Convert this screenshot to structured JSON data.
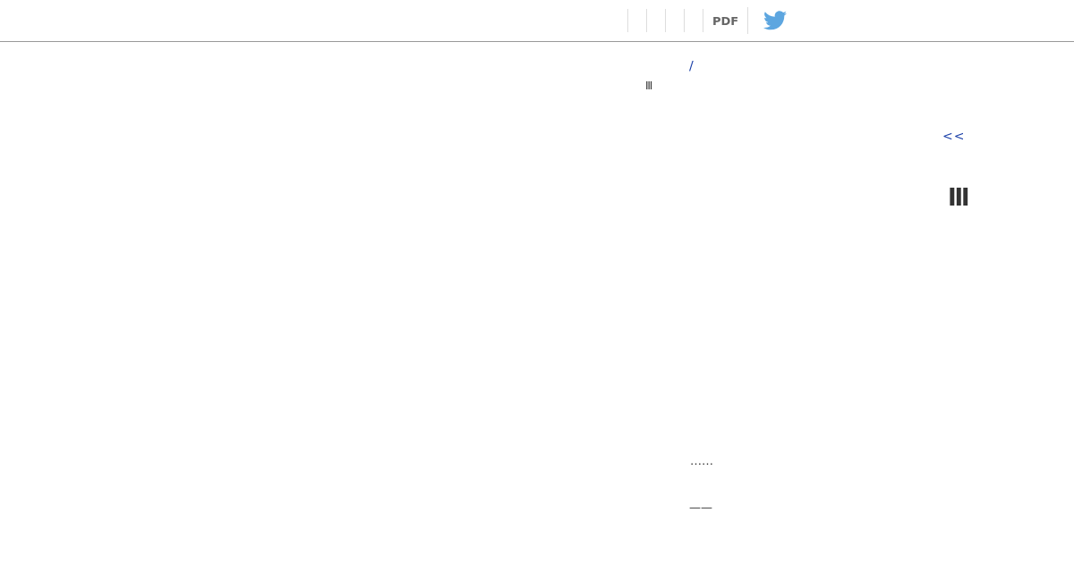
{
  "toolbar": {
    "pdf_label": "PDF"
  },
  "content": {
    "breadcrumb_separator": "/",
    "chapter_mark_small": "Ⅲ",
    "back_link": "<<",
    "chapter_mark_large": "Ⅲ",
    "ellipsis": "……",
    "dash": "——"
  }
}
